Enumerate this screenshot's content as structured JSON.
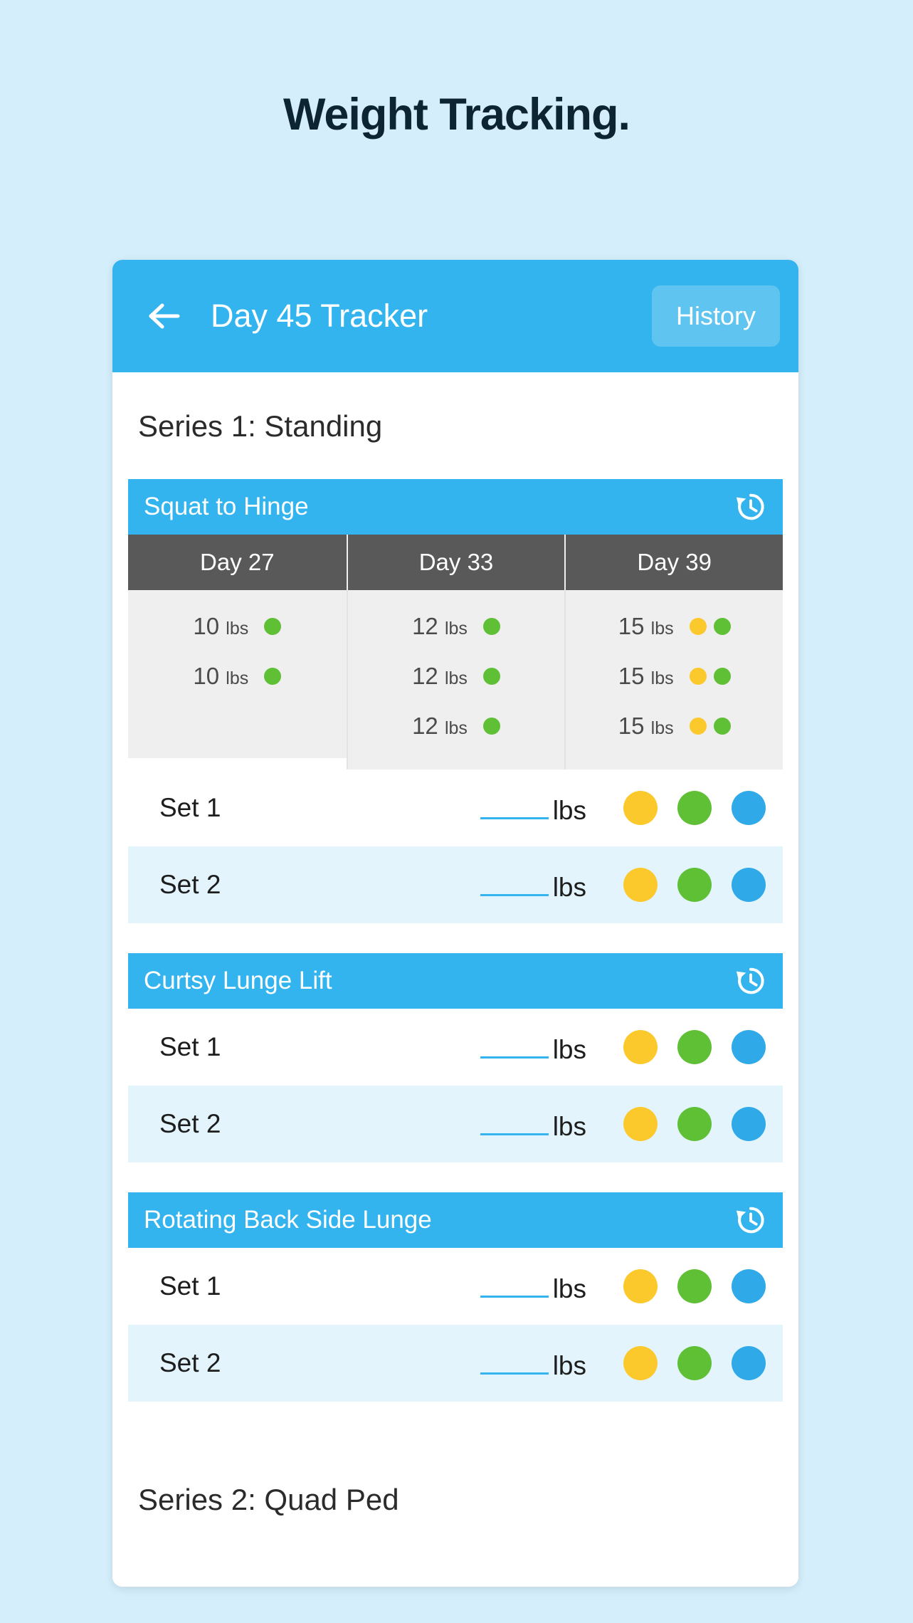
{
  "page": {
    "title": "Weight Tracking.",
    "background_color": "#d4eefb",
    "title_color": "#0d2433"
  },
  "colors": {
    "accent_blue": "#34b4ee",
    "header_gray": "#595959",
    "dot_yellow": "#fbc92b",
    "dot_green": "#5fc035",
    "dot_blue": "#2fa9e8",
    "row_alt": "#e3f4fd"
  },
  "appbar": {
    "back_icon": "arrow-left-icon",
    "title": "Day 45 Tracker",
    "history_label": "History"
  },
  "series": [
    {
      "label": "Series 1: Standing"
    },
    {
      "label": "Series 2: Quad Ped"
    }
  ],
  "exercises": [
    {
      "name": "Squat to Hinge",
      "history_icon": "history-clock-icon",
      "has_history_table": true,
      "history": {
        "columns": [
          "Day 27",
          "Day 33",
          "Day 39"
        ],
        "cells": [
          [
            {
              "weight": "10",
              "unit": "lbs",
              "dots": [
                "#5fc035"
              ]
            },
            {
              "weight": "10",
              "unit": "lbs",
              "dots": [
                "#5fc035"
              ]
            }
          ],
          [
            {
              "weight": "12",
              "unit": "lbs",
              "dots": [
                "#5fc035"
              ]
            },
            {
              "weight": "12",
              "unit": "lbs",
              "dots": [
                "#5fc035"
              ]
            },
            {
              "weight": "12",
              "unit": "lbs",
              "dots": [
                "#5fc035"
              ]
            }
          ],
          [
            {
              "weight": "15",
              "unit": "lbs",
              "dots": [
                "#fbc92b",
                "#5fc035"
              ]
            },
            {
              "weight": "15",
              "unit": "lbs",
              "dots": [
                "#fbc92b",
                "#5fc035"
              ]
            },
            {
              "weight": "15",
              "unit": "lbs",
              "dots": [
                "#fbc92b",
                "#5fc035"
              ]
            }
          ]
        ]
      },
      "sets": [
        {
          "label": "Set 1",
          "value": "",
          "placeholder": "",
          "unit": "lbs",
          "dots": [
            "#fbc92b",
            "#5fc035",
            "#2fa9e8"
          ]
        },
        {
          "label": "Set 2",
          "value": "",
          "placeholder": "",
          "unit": "lbs",
          "dots": [
            "#fbc92b",
            "#5fc035",
            "#2fa9e8"
          ]
        }
      ]
    },
    {
      "name": "Curtsy Lunge Lift",
      "history_icon": "history-clock-icon",
      "has_history_table": false,
      "sets": [
        {
          "label": "Set 1",
          "value": "",
          "placeholder": "",
          "unit": "lbs",
          "dots": [
            "#fbc92b",
            "#5fc035",
            "#2fa9e8"
          ]
        },
        {
          "label": "Set 2",
          "value": "",
          "placeholder": "",
          "unit": "lbs",
          "dots": [
            "#fbc92b",
            "#5fc035",
            "#2fa9e8"
          ]
        }
      ]
    },
    {
      "name": "Rotating Back Side Lunge",
      "history_icon": "history-clock-icon",
      "has_history_table": false,
      "sets": [
        {
          "label": "Set 1",
          "value": "",
          "placeholder": "",
          "unit": "lbs",
          "dots": [
            "#fbc92b",
            "#5fc035",
            "#2fa9e8"
          ]
        },
        {
          "label": "Set 2",
          "value": "",
          "placeholder": "",
          "unit": "lbs",
          "dots": [
            "#fbc92b",
            "#5fc035",
            "#2fa9e8"
          ]
        }
      ]
    }
  ]
}
